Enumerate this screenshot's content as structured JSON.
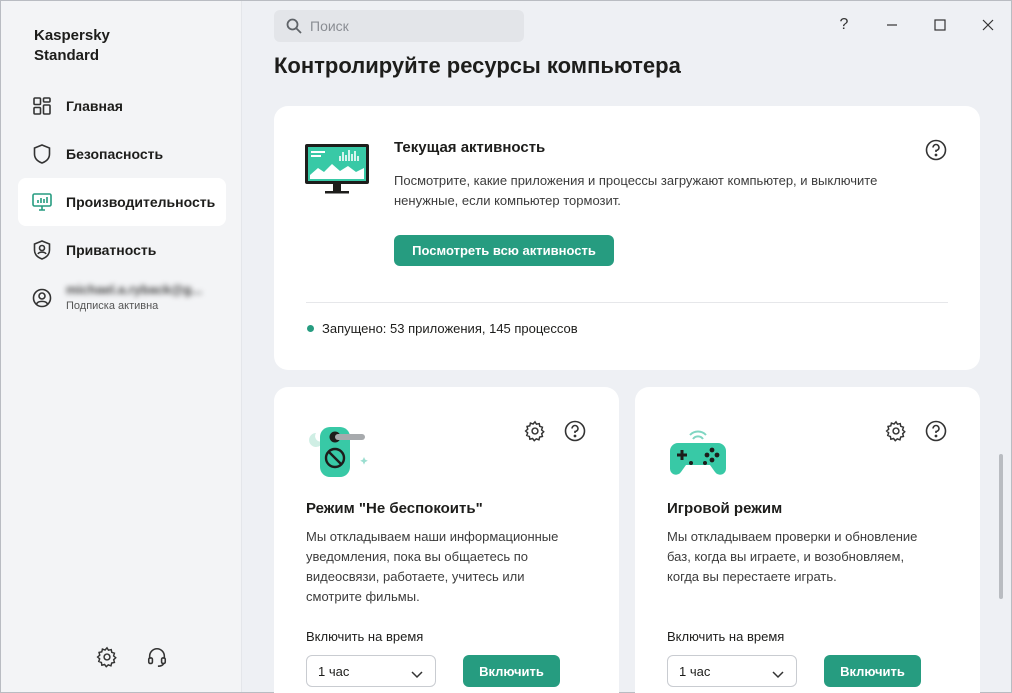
{
  "app": {
    "brand_line1": "Kaspersky",
    "brand_line2": "Standard"
  },
  "sidebar": {
    "items": [
      {
        "label": "Главная",
        "icon": "dashboard-icon"
      },
      {
        "label": "Безопасность",
        "icon": "shield-icon"
      },
      {
        "label": "Производительность",
        "icon": "monitor-performance-icon",
        "active": true
      },
      {
        "label": "Приватность",
        "icon": "privacy-shield-icon"
      }
    ],
    "account": {
      "name": "michael.a.ryback@g...",
      "status": "Подписка активна",
      "icon": "user-icon"
    },
    "bottom": [
      "gear-icon",
      "headset-icon"
    ]
  },
  "search": {
    "placeholder": "Поиск"
  },
  "window_controls": [
    "?",
    "minimize",
    "maximize",
    "close"
  ],
  "page": {
    "title": "Контролируйте ресурсы компьютера"
  },
  "activity": {
    "title": "Текущая активность",
    "description_l1": "Посмотрите, какие приложения и процессы загружают компьютер, и выключите",
    "description_l2": "ненужные, если компьютер тормозит.",
    "button": "Посмотреть всю активность",
    "status": "Запущено: 53 приложения, 145 процессов"
  },
  "dnd": {
    "title": "Режим \"Не беспокоить\"",
    "description": [
      "Мы откладываем наши информационные",
      "уведомления, пока вы общаетесь по",
      "видеосвязи, работаете, учитесь или",
      "смотрите фильмы."
    ],
    "timer_label": "Включить на время",
    "timer_value": "1 час",
    "button": "Включить"
  },
  "game": {
    "title": "Игровой режим",
    "description": [
      "Мы откладываем проверки и обновление",
      "баз, когда вы играете, и возобновляем,",
      "когда вы перестаете играть."
    ],
    "timer_label": "Включить на время",
    "timer_value": "1 час",
    "button": "Включить"
  },
  "colors": {
    "accent": "#269c80",
    "sidebar_bg": "#f3f4f6",
    "page_bg": "#eef0f4"
  }
}
